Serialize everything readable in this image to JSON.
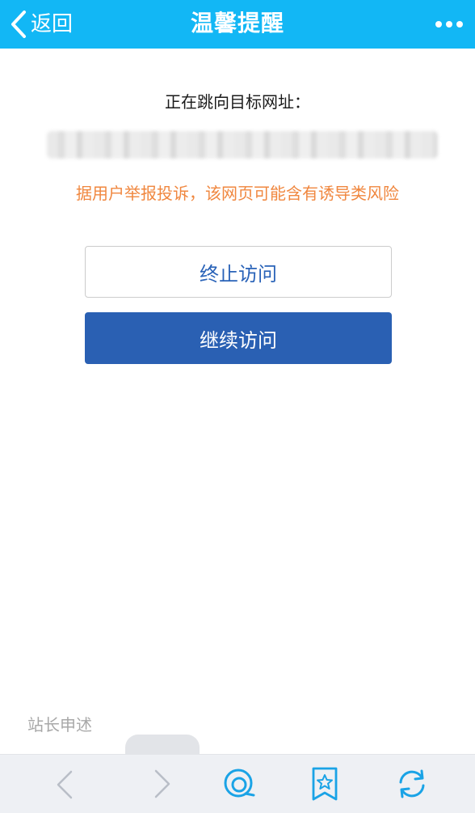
{
  "header": {
    "back_label": "返回",
    "title": "温馨提醒",
    "background_color": "#12b7f5"
  },
  "main": {
    "redirect_label": "正在跳向目标网址：",
    "warning_text": "据用户举报投诉，该网页可能含有诱导类风险",
    "warning_color": "#f0873f",
    "stop_button_label": "终止访问",
    "continue_button_label": "继续访问",
    "continue_button_color": "#2a60b3",
    "statement_link": "站长申述"
  },
  "toolbar": {
    "items": [
      {
        "name": "back",
        "icon": "chevron-left-icon"
      },
      {
        "name": "forward",
        "icon": "chevron-right-icon"
      },
      {
        "name": "qq-browser",
        "icon": "qq-browser-icon"
      },
      {
        "name": "bookmark",
        "icon": "bookmark-star-icon"
      },
      {
        "name": "refresh",
        "icon": "refresh-icon"
      }
    ],
    "icon_color": "#1aa3e6"
  }
}
